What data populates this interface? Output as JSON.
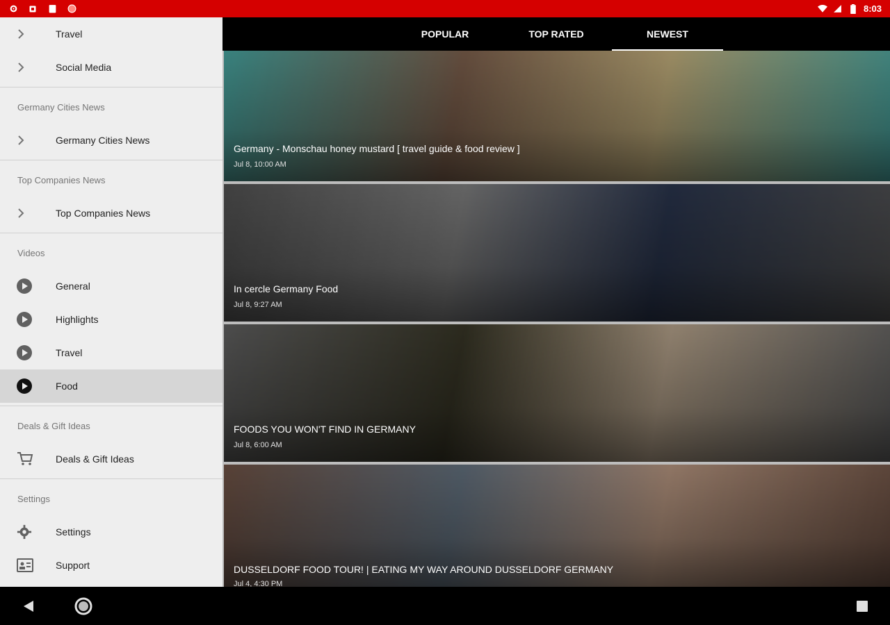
{
  "status_bar": {
    "time": "8:03",
    "left_icons": [
      "settings-icon",
      "sim-icon",
      "clipboard-icon",
      "app-icon"
    ],
    "right_icons": [
      "wifi-icon",
      "signal-icon",
      "battery-icon"
    ]
  },
  "drawer": {
    "top_items": [
      {
        "label": "Travel",
        "icon": "chevron-right-icon"
      },
      {
        "label": "Social Media",
        "icon": "chevron-right-icon"
      }
    ],
    "sections": [
      {
        "header": "Germany Cities News",
        "items": [
          {
            "label": "Germany Cities News",
            "icon": "chevron-right-icon"
          }
        ]
      },
      {
        "header": "Top Companies News",
        "items": [
          {
            "label": "Top Companies News",
            "icon": "chevron-right-icon"
          }
        ]
      },
      {
        "header": "Videos",
        "items": [
          {
            "label": "General",
            "icon": "play-circle-icon"
          },
          {
            "label": "Highlights",
            "icon": "play-circle-icon"
          },
          {
            "label": "Travel",
            "icon": "play-circle-icon"
          },
          {
            "label": "Food",
            "icon": "play-circle-icon",
            "selected": true
          }
        ]
      },
      {
        "header": "Deals & Gift Ideas",
        "items": [
          {
            "label": "Deals & Gift Ideas",
            "icon": "cart-icon"
          }
        ]
      },
      {
        "header": "Settings",
        "items": [
          {
            "label": "Settings",
            "icon": "gear-icon"
          },
          {
            "label": "Support",
            "icon": "support-icon"
          }
        ]
      }
    ]
  },
  "tabs": [
    {
      "label": "POPULAR",
      "active": false
    },
    {
      "label": "TOP RATED",
      "active": false
    },
    {
      "label": "NEWEST",
      "active": true
    }
  ],
  "videos": [
    {
      "title": "Germany - Monschau honey mustard [ travel guide & food review ]",
      "date": "Jul 8, 10:00 AM",
      "colors": [
        "#4fb6b1",
        "#d8c28a",
        "#8a6a55"
      ]
    },
    {
      "title": "In cercle Germany Food",
      "date": "Jul 8, 9:27 AM",
      "colors": [
        "#5a5a5a",
        "#2e3a55",
        "#8c8c8c"
      ]
    },
    {
      "title": "FOODS YOU WON'T FIND IN GERMANY",
      "date": "Jul 8, 6:00 AM",
      "colors": [
        "#6b6b6b",
        "#c9b49a",
        "#3d3b2a"
      ]
    },
    {
      "title": "DUSSELDORF FOOD TOUR! | EATING MY WAY AROUND DUSSELDORF GERMANY",
      "date": "Jul 4, 4:30 PM",
      "colors": [
        "#7a5b4c",
        "#c9a58d",
        "#6e7d8c"
      ]
    }
  ],
  "nav_bar": {
    "buttons": [
      "back-icon",
      "home-icon",
      "recents-icon"
    ]
  }
}
